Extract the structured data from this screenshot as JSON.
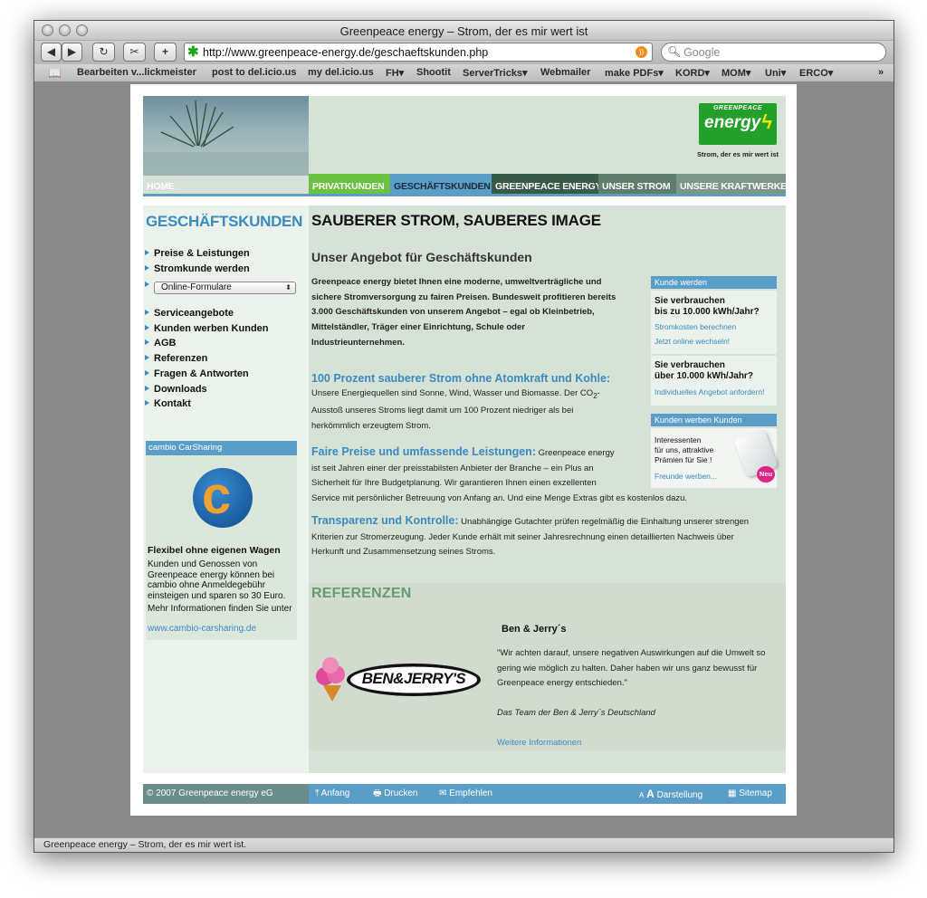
{
  "browser": {
    "window_title": "Greenpeace energy – Strom, der es mir wert ist",
    "url": "http://www.greenpeace-energy.de/geschaeftskunden.php",
    "search_placeholder": "Google",
    "bookmarks": [
      "Bearbeiten v...lickmeister",
      "post to del.icio.us",
      "my del.icio.us",
      "FH▾",
      "Shootit",
      "ServerTricks▾",
      "Webmailer",
      "make PDFs▾",
      "KORD▾",
      "MOM▾",
      "Uni▾",
      "ERCO▾"
    ],
    "status_text": "Greenpeace energy – Strom, der es mir wert ist."
  },
  "header": {
    "logo_top": "GREENPEACE",
    "logo_main": "energy",
    "slogan": "Strom, der es mir wert ist",
    "nav": [
      "HOME",
      "PRIVATKUNDEN",
      "GESCHÄFTSKUNDEN",
      "GREENPEACE ENERGY",
      "UNSER STROM",
      "UNSERE KRAFTWERKE"
    ]
  },
  "left": {
    "section_title": "GESCHÄFTSKUNDEN",
    "nav1": [
      "Preise & Leistungen",
      "Stromkunde werden"
    ],
    "select_value": "Online-Formulare",
    "nav2": [
      "Serviceangebote",
      "Kunden werben Kunden",
      "AGB",
      "Referenzen",
      "Fragen & Antworten",
      "Downloads",
      "Kontakt"
    ],
    "cambio_head": "cambio CarSharing",
    "cambio_title": "Flexibel ohne eigenen Wagen",
    "cambio_text": "Kunden und Genossen von Greenpeace energy können bei cambio ohne Anmeldegebühr einsteigen und sparen so 30 Euro.",
    "cambio_more": "Mehr Informationen finden Sie unter",
    "cambio_link": "www.cambio-carsharing.de"
  },
  "main": {
    "h1": "SAUBERER STROM, SAUBERES IMAGE",
    "h2": "Unser Angebot für Geschäftskunden",
    "intro": [
      "Greenpeace energy bietet Ihnen eine moderne, umweltverträgliche und",
      "sichere Stromversorgung zu fairen Preisen. Bundesweit profitieren bereits",
      "3.000 Geschäftskunden von unserem Angebot – egal ob Kleinbetrieb,",
      "Mittelständler, Träger einer Einrichtung, Schule oder",
      "Industrieunternehmen."
    ],
    "p1_head": "100 Prozent sauberer Strom ohne Atomkraft und Kohle:",
    "p1_line1": "Unsere Energiequellen sind Sonne, Wind, Wasser und Biomasse. Der CO",
    "p1_sub": "2",
    "p1_dash": "-",
    "p1_rest": [
      "Ausstoß unseres Stroms liegt damit um 100 Prozent niedriger als bei",
      "herkömmlich erzeugtem Strom."
    ],
    "p2_head": "Faire Preise und umfassende Leistungen:",
    "p2_first": "Greenpeace energy",
    "p2_rest": [
      "ist seit Jahren einer der preisstabilsten Anbieter der Branche – ein Plus an",
      "Sicherheit für Ihre Budgetplanung. Wir garantieren Ihnen einen exzellenten",
      "Service mit persönlicher Betreuung von Anfang an. Und eine Menge Extras gibt es kostenlos dazu."
    ],
    "p3_head": "Transparenz und Kontrolle:",
    "p3_first": "Unabhängige Gutachter prüfen regelmäßig die Einhaltung unserer strengen",
    "p3_rest": [
      "Kriterien zur Stromerzeugung. Jeder Kunde erhält mit seiner Jahresrechnung einen detaillierten Nachweis über",
      "Herkunft und Zusammensetzung seines Stroms."
    ]
  },
  "sidebox": {
    "head1": "Kunde werden",
    "q1": [
      "Sie verbrauchen",
      "bis zu 10.000 kWh/Jahr?"
    ],
    "l1": "Stromkosten berechnen",
    "l2": "Jetzt online wechseln!",
    "q2": [
      "Sie verbrauchen",
      "über 10.000 kWh/Jahr?"
    ],
    "l3": "Individuelles Angebot anfordern!",
    "head2": "Kunden werben Kunden",
    "kwk_text": [
      "Interessenten",
      "für uns, attraktive",
      "Prämien für Sie !"
    ],
    "kwk_link": "Freunde werben...",
    "badge": "Neu"
  },
  "refs": {
    "title": "REFERENZEN",
    "logo_text": "BEN&JERRY'S",
    "name": "Ben & Jerry´s",
    "quote": [
      "\"Wir achten darauf, unsere negativen Auswirkungen auf die Umwelt so",
      "gering wie möglich zu halten. Daher haben wir uns ganz bewusst für",
      "Greenpeace energy entschieden.\""
    ],
    "signature": "Das Team der Ben & Jerry´s Deutschland",
    "more": "Weitere Informationen"
  },
  "footer": {
    "copyright": "© 2007 Greenpeace energy eG",
    "links": [
      "Anfang",
      "Drucken",
      "Empfehlen",
      "Darstellung",
      "Sitemap"
    ],
    "font_small": "A",
    "font_big": "A"
  },
  "colors": {
    "accent_blue": "#3b8ac0",
    "nav_green": "#6ac142",
    "page_green": "#d6e2d6"
  }
}
